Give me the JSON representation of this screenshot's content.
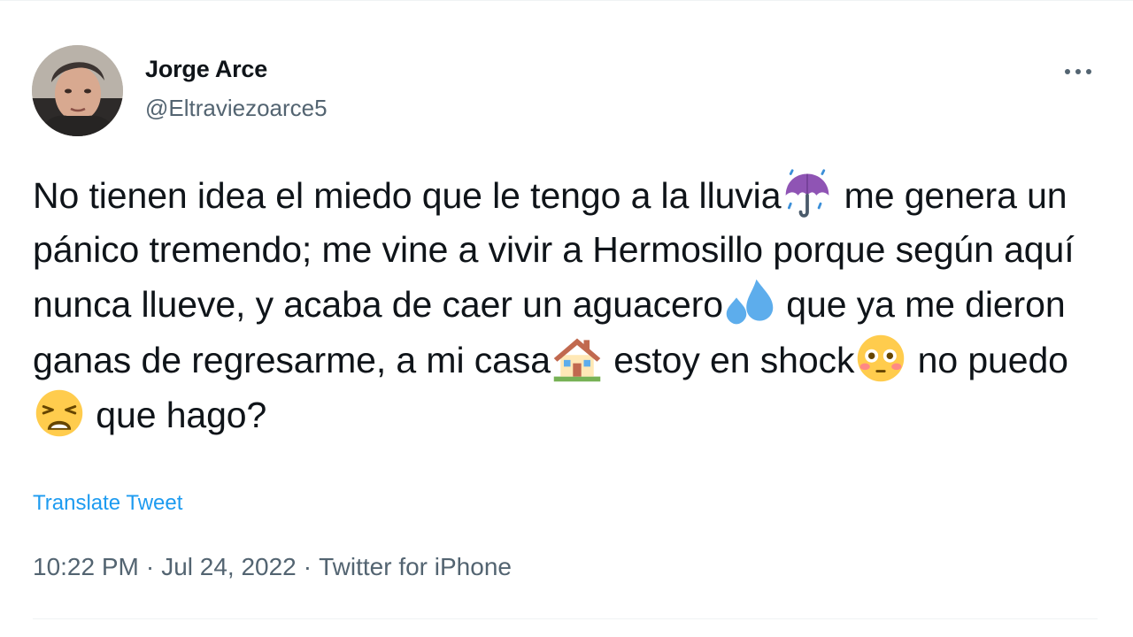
{
  "author": {
    "name": "Jorge Arce",
    "handle": "@Eltraviezoarce5",
    "avatar_icon": "profile-photo"
  },
  "more_icon": "more-horizontal-icon",
  "tweet": {
    "segments": [
      {
        "type": "text",
        "value": "No tienen idea el miedo que le tengo a la lluvia"
      },
      {
        "type": "emoji",
        "name": "umbrella-rain-icon"
      },
      {
        "type": "text",
        "value": " me genera un pánico tremendo; me vine a vivir a Hermosillo porque según aquí nunca llueve, y acaba de caer un aguacero"
      },
      {
        "type": "emoji",
        "name": "sweat-droplets-icon"
      },
      {
        "type": "text",
        "value": " que ya me dieron ganas de regresarme, a mi casa"
      },
      {
        "type": "emoji",
        "name": "house-icon"
      },
      {
        "type": "text",
        "value": " estoy en shock"
      },
      {
        "type": "emoji",
        "name": "flushed-face-icon"
      },
      {
        "type": "text",
        "value": " no puedo "
      },
      {
        "type": "emoji",
        "name": "weary-face-icon"
      },
      {
        "type": "text",
        "value": " que hago?"
      }
    ]
  },
  "translate_label": "Translate Tweet",
  "meta": {
    "time": "10:22 PM",
    "separator": "·",
    "date": "Jul 24, 2022",
    "source": "Twitter for iPhone"
  },
  "colors": {
    "text": "#0f1419",
    "secondary": "#536471",
    "link": "#1d9bf0",
    "divider": "#eff3f4"
  }
}
